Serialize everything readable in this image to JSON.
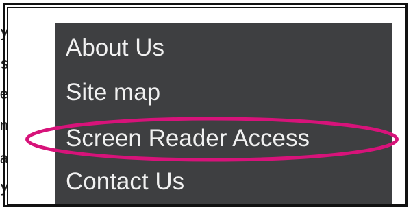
{
  "background_text": {
    "fragments": [
      "y",
      "s",
      "e",
      "n",
      "a",
      "y"
    ]
  },
  "menu": {
    "items": [
      {
        "label": "About Us"
      },
      {
        "label": "Site map"
      },
      {
        "label": "Screen Reader Access"
      },
      {
        "label": "Contact Us"
      }
    ]
  },
  "colors": {
    "menu_background": "#3e3f41",
    "menu_text": "#f1f1f1",
    "highlight_ring": "#d7137a"
  }
}
